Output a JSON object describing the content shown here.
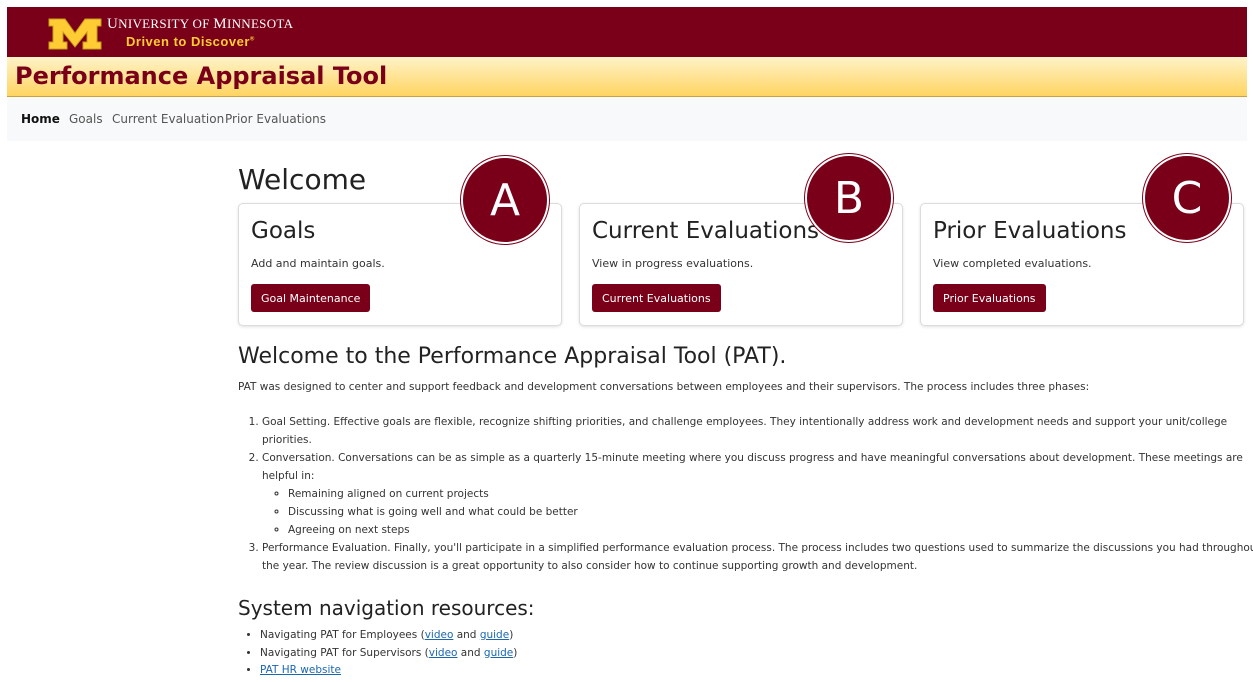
{
  "header": {
    "university_first": "U",
    "university_rest": "NIVERSITY OF ",
    "university_first2": "M",
    "university_rest2": "INNESOTA",
    "tagline": "Driven to Discover",
    "tagline_mark": "®",
    "app_title": "Performance Appraisal Tool"
  },
  "nav": {
    "items": [
      "Home",
      "Goals",
      "Current Evaluation",
      "Prior Evaluations"
    ],
    "active": "Home"
  },
  "main": {
    "welcome": "Welcome",
    "cards": [
      {
        "title": "Goals",
        "text": "Add and maintain goals.",
        "button": "Goal Maintenance",
        "badge": "A"
      },
      {
        "title": "Current Evaluations",
        "text": "View in progress evaluations.",
        "button": "Current Evaluations",
        "badge": "B"
      },
      {
        "title": "Prior Evaluations",
        "text": "View completed evaluations.",
        "button": "Prior Evaluations",
        "badge": "C"
      }
    ],
    "intro_heading": "Welcome to the Performance Appraisal Tool (PAT).",
    "intro_text": "PAT was designed to center and support feedback and development conversations between employees and their supervisors. The process includes three phases:",
    "phases": [
      {
        "text": "Goal Setting. Effective goals are flexible, recognize shifting priorities, and challenge employees. They intentionally address work and development needs and support your unit/college priorities."
      },
      {
        "text": "Conversation. Conversations can be as simple as a quarterly 15-minute meeting where you discuss progress and have meaningful conversations about development. These meetings are helpful in:",
        "subitems": [
          "Remaining aligned on current projects",
          "Discussing what is going well and what could be better",
          "Agreeing on next steps"
        ]
      },
      {
        "text": "Performance Evaluation. Finally, you'll participate in a simplified performance evaluation process. The process includes two questions used to summarize the discussions you had throughout the year. The review discussion is a great opportunity to also consider how to continue supporting growth and development."
      }
    ],
    "resources_heading": "System navigation resources:",
    "resources": [
      {
        "prefix": "Navigating PAT for Employees (",
        "link1": "video",
        "middle": " and ",
        "link2": "guide",
        "suffix": ")"
      },
      {
        "prefix": "Navigating PAT for Supervisors (",
        "link1": "video",
        "middle": " and ",
        "link2": "guide",
        "suffix": ")"
      },
      {
        "link": "PAT HR website"
      }
    ]
  },
  "colors": {
    "maroon": "#7a0019",
    "gold": "#ffcc33",
    "link": "#1a66b0"
  }
}
